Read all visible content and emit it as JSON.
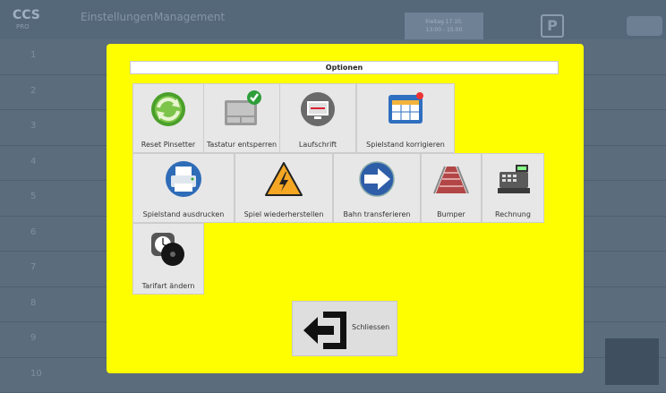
{
  "background": {
    "logo": "CCS",
    "logo_sub": "PRO",
    "menu": [
      "Einstellungen",
      "Management"
    ],
    "date_lines": [
      "Freitag 17.10.",
      "13:00 - 15:00",
      "Montag 20.10."
    ],
    "p_button": "P",
    "rows": [
      "1",
      "2",
      "3",
      "4",
      "5",
      "6",
      "7",
      "8",
      "9",
      "10"
    ]
  },
  "dialog": {
    "title": "Optionen",
    "buttons": [
      {
        "label": "Reset Pinsetter",
        "icon": "reset-pinsetter-icon"
      },
      {
        "label": "Tastatur entsperren",
        "icon": "keyboard-unlock-icon"
      },
      {
        "label": "Laufschrift",
        "icon": "monitor-icon"
      },
      {
        "label": "Spielstand korrigieren",
        "icon": "scoreboard-icon"
      },
      {
        "label": "Spielstand ausdrucken",
        "icon": "printer-icon"
      },
      {
        "label": "Spiel wiederherstellen",
        "icon": "warning-lightning-icon"
      },
      {
        "label": "Bahn transferieren",
        "icon": "arrow-right-icon"
      },
      {
        "label": "Bumper",
        "icon": "bumper-lane-icon"
      },
      {
        "label": "Rechnung",
        "icon": "cash-register-icon"
      },
      {
        "label": "Tarifart ändern",
        "icon": "clock-tariff-icon"
      }
    ],
    "close_label": "Schliessen",
    "close_icon": "exit-icon",
    "colors": {
      "dialog_bg": "#fefe00",
      "button_bg": "#e7e7e7"
    }
  }
}
